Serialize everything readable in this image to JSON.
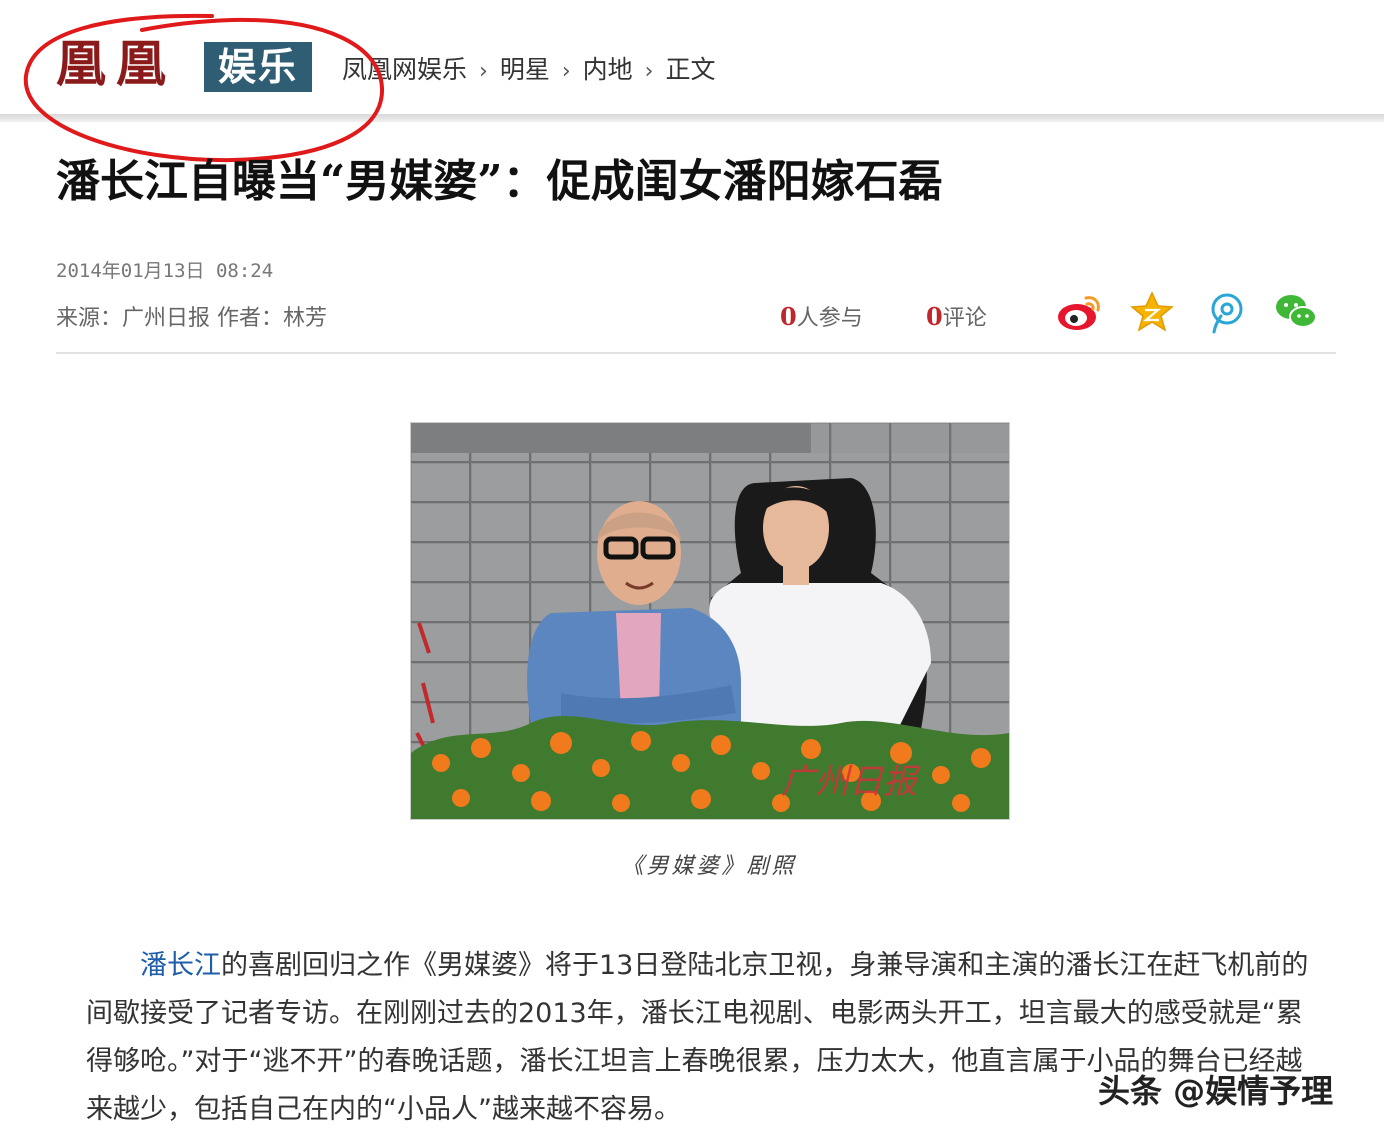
{
  "header": {
    "logo_phoenix": "凰凰",
    "logo_section": "娱乐",
    "breadcrumb": [
      "凤凰网娱乐",
      "明星",
      "内地",
      "正文"
    ],
    "breadcrumb_separator": "›"
  },
  "article": {
    "title": "潘长江自曝当“男媒婆”：促成闺女潘阳嫁石磊",
    "datetime": "2014年01月13日 08:24",
    "source_line": "来源：广州日报 作者：林芳",
    "participants_count": "0",
    "participants_label": "人参与",
    "comments_count": "0",
    "comments_label": "评论",
    "photo_caption": "《男媒婆》剧照",
    "photo_watermark": "广州日报",
    "body_link": "潘长江",
    "body_text": "的喜剧回归之作《男媒婆》将于13日登陆北京卫视，身兼导演和主演的潘长江在赶飞机前的间歇接受了记者专访。在刚刚过去的2013年，潘长江电视剧、电影两头开工，坦言最大的感受就是“累得够呛。”对于“逃不开”的春晚话题，潘长江坦言上春晚很累，压力太大，他直言属于小品的舞台已经越来越少，包括自己在内的“小品人”越来越不容易。"
  },
  "share_icons": [
    "weibo-icon",
    "qzone-star-icon",
    "tencent-weibo-icon",
    "wechat-icon"
  ],
  "watermark": "头条 @娱情予理",
  "colors": {
    "logo_red": "#8b1a1a",
    "section_bg": "#2f5d73",
    "highlight_circle": "#e0191b",
    "count_red": "#c0272d",
    "link_blue": "#1f5ea8"
  }
}
